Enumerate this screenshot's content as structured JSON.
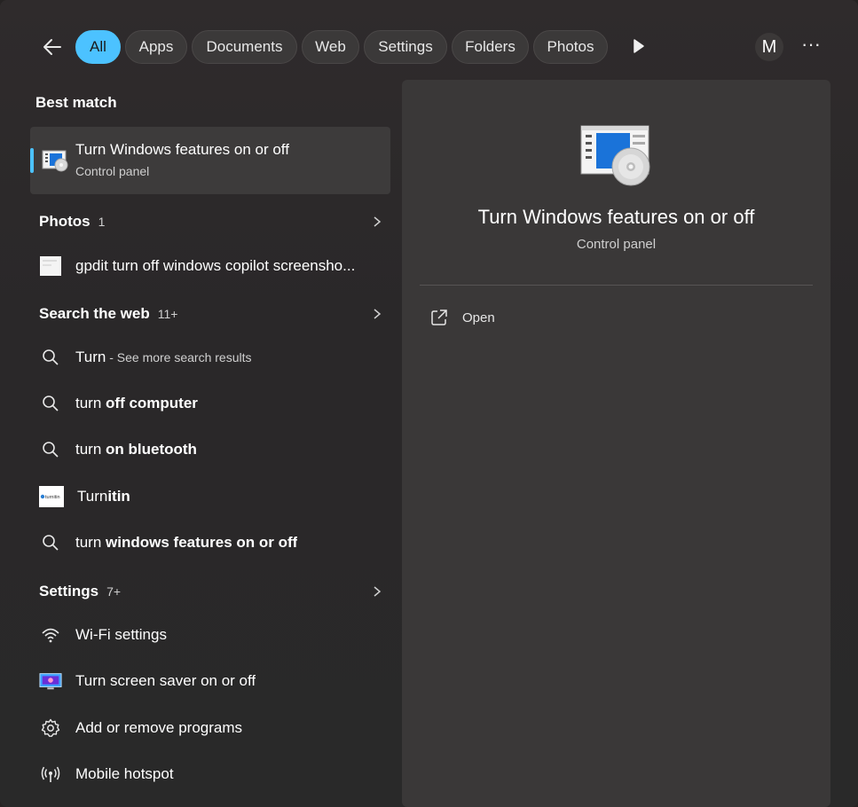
{
  "filters": {
    "back_icon": "arrow-left-icon",
    "tabs": [
      {
        "label": "All",
        "active": true
      },
      {
        "label": "Apps"
      },
      {
        "label": "Documents"
      },
      {
        "label": "Web"
      },
      {
        "label": "Settings"
      },
      {
        "label": "Folders"
      },
      {
        "label": "Photos"
      }
    ],
    "avatar_letter": "M",
    "more_label": "···",
    "accent_color": "#4cc2ff"
  },
  "best_match": {
    "heading": "Best match",
    "title": "Turn Windows features on or off",
    "subtitle": "Control panel"
  },
  "photos": {
    "heading": "Photos",
    "count": "1",
    "items": [
      {
        "label": "gpdit turn off windows copilot screensho..."
      }
    ]
  },
  "web": {
    "heading": "Search the web",
    "count": "11+",
    "items": [
      {
        "prefix": "Turn",
        "bold": "",
        "suffix": " - See more search results"
      },
      {
        "prefix": "turn ",
        "bold": "off computer",
        "suffix": ""
      },
      {
        "prefix": "turn ",
        "bold": "on bluetooth",
        "suffix": ""
      },
      {
        "prefix": "Turn",
        "bold": "itin",
        "suffix": ""
      },
      {
        "prefix": "turn ",
        "bold": "windows features on or off",
        "suffix": ""
      }
    ],
    "logo_text": "turnitin"
  },
  "settings": {
    "heading": "Settings",
    "count": "7+",
    "items": [
      {
        "label": "Wi-Fi settings",
        "icon": "wifi-icon"
      },
      {
        "label": "Turn screen saver on or off",
        "icon": "screen-saver-icon"
      },
      {
        "label": "Add or remove programs",
        "icon": "gear-icon"
      },
      {
        "label": "Mobile hotspot",
        "icon": "hotspot-icon"
      }
    ]
  },
  "preview": {
    "title": "Turn Windows features on or off",
    "subtitle": "Control panel",
    "open_label": "Open"
  }
}
